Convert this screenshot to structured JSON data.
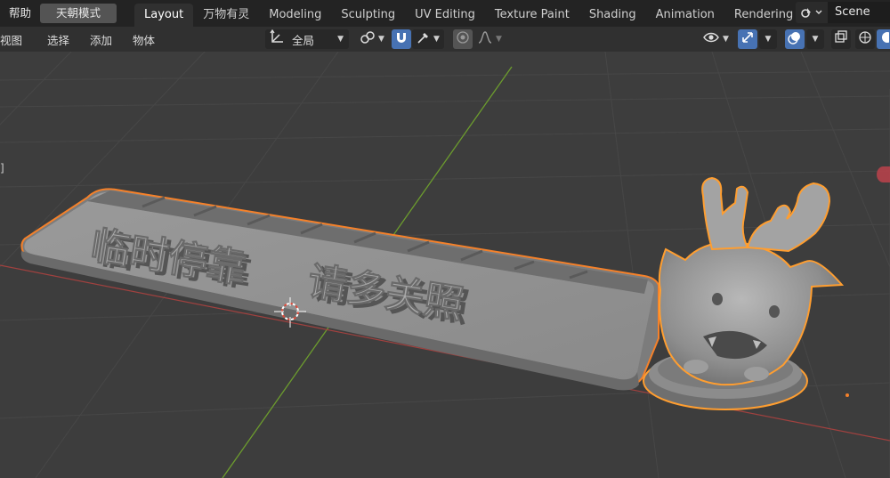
{
  "topbar": {
    "help": "帮助",
    "mode": "天朝模式",
    "workspaces": [
      "Layout",
      "万物有灵",
      "Modeling",
      "Sculpting",
      "UV Editing",
      "Texture Paint",
      "Shading",
      "Animation",
      "Rendering",
      "C"
    ],
    "active_workspace": "Layout",
    "scene_icon": "scene-icon",
    "scene": "Scene"
  },
  "header": {
    "menus": [
      "视图",
      "选择",
      "添加",
      "物体"
    ],
    "orientation_icon": "transform-orientation-icon",
    "orientation": "全局",
    "pivot_icon": "pivot-point-icon",
    "snap_icon": "magnet-snap-icon",
    "snap_target_icon": "snap-target-icon",
    "proportional_icon": "proportional-edit-icon",
    "falloff_icon": "falloff-curve-icon",
    "visibility_icon": "eye-visibility-icon",
    "gizmo_icon": "gizmo-icon",
    "overlay_icon": "overlay-icon",
    "xray_icon": "xray-icon",
    "shading_icon": "shading-icon"
  },
  "viewport": {
    "side_label": "]",
    "model_text": "临时停靠  请多关照",
    "colors": {
      "background": "#3d3d3d",
      "grid": "#4a4a4a",
      "x_axis": "#a0413f",
      "y_axis": "#6c9c2e",
      "selection": "#f5812a",
      "active_outline": "#ff9e30",
      "model": "#8f8f8f"
    }
  }
}
